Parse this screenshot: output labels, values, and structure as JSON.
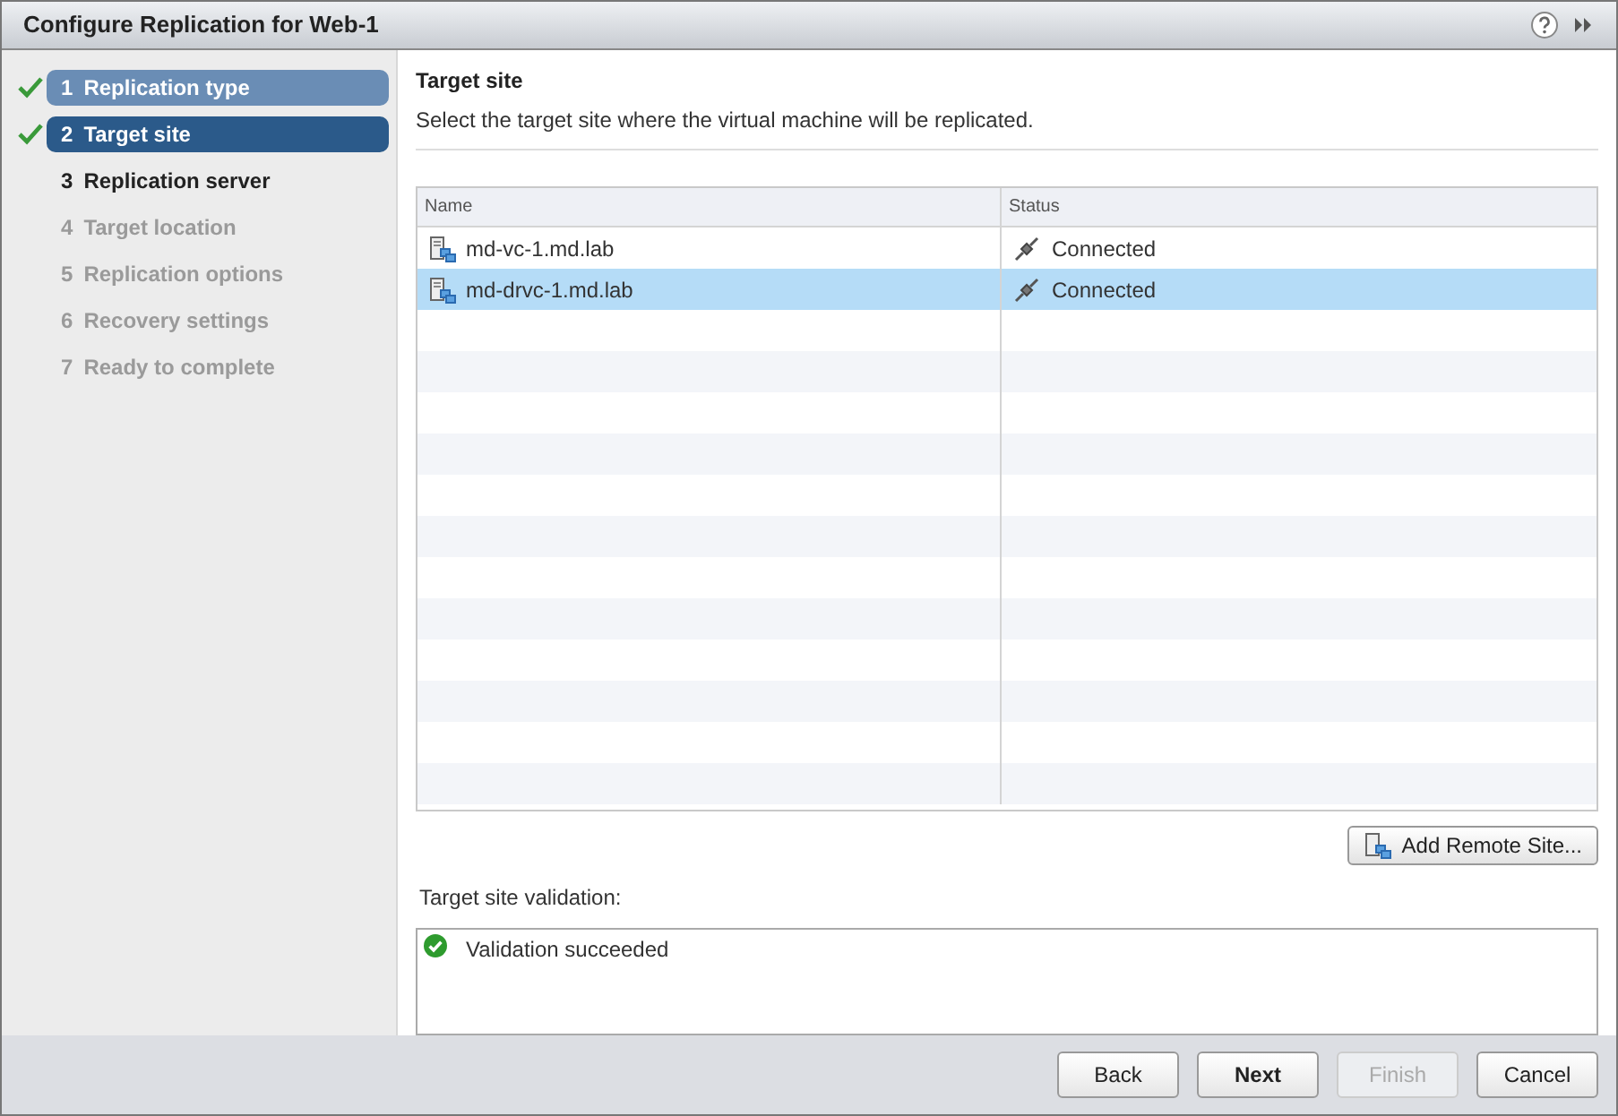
{
  "window": {
    "title": "Configure Replication for Web-1"
  },
  "steps": [
    {
      "number": "1",
      "label": "Replication type",
      "completed": true,
      "selected": false,
      "disabled": false
    },
    {
      "number": "2",
      "label": "Target site",
      "completed": true,
      "selected": true,
      "disabled": false
    },
    {
      "number": "3",
      "label": "Replication server",
      "completed": false,
      "selected": false,
      "disabled": false
    },
    {
      "number": "4",
      "label": "Target location",
      "completed": false,
      "selected": false,
      "disabled": true
    },
    {
      "number": "5",
      "label": "Replication options",
      "completed": false,
      "selected": false,
      "disabled": true
    },
    {
      "number": "6",
      "label": "Recovery settings",
      "completed": false,
      "selected": false,
      "disabled": true
    },
    {
      "number": "7",
      "label": "Ready to complete",
      "completed": false,
      "selected": false,
      "disabled": true
    }
  ],
  "page": {
    "title": "Target site",
    "description": "Select the target site where the virtual machine will be replicated."
  },
  "table": {
    "columns": [
      "Name",
      "Status"
    ],
    "rows": [
      {
        "name": "md-vc-1.md.lab",
        "status": "Connected",
        "selected": false
      },
      {
        "name": "md-drvc-1.md.lab",
        "status": "Connected",
        "selected": true
      }
    ]
  },
  "add_button": "Add Remote Site...",
  "validation": {
    "label": "Target site validation:",
    "message": "Validation succeeded"
  },
  "buttons": [
    {
      "label": "Back",
      "disabled": false,
      "primary": false
    },
    {
      "label": "Next",
      "disabled": false,
      "primary": true
    },
    {
      "label": "Finish",
      "disabled": true,
      "primary": false
    },
    {
      "label": "Cancel",
      "disabled": false,
      "primary": false
    }
  ]
}
